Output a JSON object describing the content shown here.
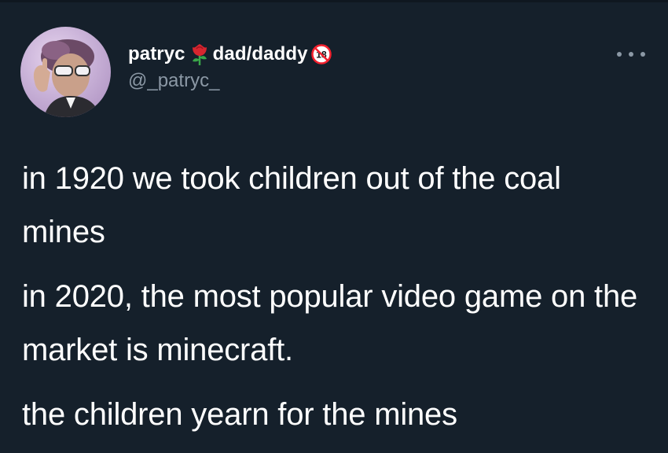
{
  "tweet": {
    "author": {
      "display_name_part1": "patryc",
      "display_name_part2": "dad/daddy",
      "handle": "@_patryc_",
      "emoji_icons": [
        "rose-icon",
        "no-one-under-eighteen-icon"
      ]
    },
    "more_icon": "more-options-icon",
    "paragraphs": [
      "in 1920 we took children out of the coal mines",
      "in 2020, the most popular video game on the market is minecraft.",
      "the children yearn for the mines"
    ]
  },
  "colors": {
    "background": "#15202b",
    "text": "#ffffff",
    "secondary_text": "#8b98a5",
    "badge_red": "#f4212e"
  }
}
